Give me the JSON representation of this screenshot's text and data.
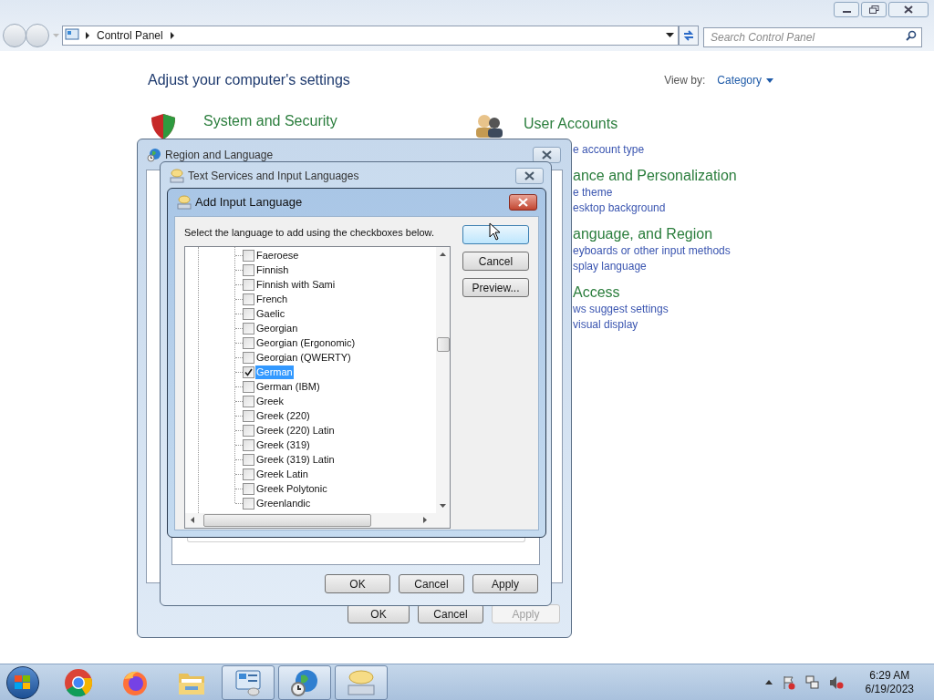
{
  "explorer": {
    "crumbs": [
      "Control Panel"
    ],
    "search_placeholder": "Search Control Panel"
  },
  "heading": "Adjust your computer's settings",
  "view_by": {
    "label": "View by:",
    "value": "Category"
  },
  "categories": [
    {
      "kind": "shield",
      "title": "System and Security"
    },
    {
      "kind": "users",
      "title": "User Accounts"
    }
  ],
  "partly_covered": [
    {
      "kind": "link",
      "text": "e account type"
    },
    {
      "kind": "heading",
      "text": "ance and Personalization"
    },
    {
      "kind": "link",
      "text": "e theme"
    },
    {
      "kind": "link",
      "text": "esktop background"
    },
    {
      "kind": "heading",
      "text": "anguage, and Region"
    },
    {
      "kind": "link",
      "text": "eyboards or other input methods"
    },
    {
      "kind": "link",
      "text": "splay language"
    },
    {
      "kind": "heading",
      "text": "Access"
    },
    {
      "kind": "link",
      "text": "ws suggest settings"
    },
    {
      "kind": "link",
      "text": "visual display"
    }
  ],
  "region_dialog": {
    "title": "Region and Language",
    "buttons": [
      {
        "label": "OK",
        "disabled": false
      },
      {
        "label": "Cancel",
        "disabled": false
      },
      {
        "label": "Apply",
        "disabled": true
      }
    ]
  },
  "text_services_dialog": {
    "title": "Text Services and Input Languages",
    "buttons": [
      {
        "label": "OK",
        "disabled": false
      },
      {
        "label": "Cancel",
        "disabled": false
      },
      {
        "label": "Apply",
        "disabled": false
      }
    ]
  },
  "add_language_dialog": {
    "title": "Add Input Language",
    "prompt": "Select the language to add using the checkboxes below.",
    "default_button_focused": true,
    "buttons": [
      {
        "label": "Cancel"
      },
      {
        "label": "Preview..."
      }
    ],
    "languages": [
      {
        "label": "Faeroese",
        "checked": false,
        "selected": false
      },
      {
        "label": "Finnish",
        "checked": false,
        "selected": false
      },
      {
        "label": "Finnish with Sami",
        "checked": false,
        "selected": false
      },
      {
        "label": "French",
        "checked": false,
        "selected": false
      },
      {
        "label": "Gaelic",
        "checked": false,
        "selected": false
      },
      {
        "label": "Georgian",
        "checked": false,
        "selected": false
      },
      {
        "label": "Georgian (Ergonomic)",
        "checked": false,
        "selected": false
      },
      {
        "label": "Georgian (QWERTY)",
        "checked": false,
        "selected": false
      },
      {
        "label": "German",
        "checked": true,
        "selected": true
      },
      {
        "label": "German (IBM)",
        "checked": false,
        "selected": false
      },
      {
        "label": "Greek",
        "checked": false,
        "selected": false
      },
      {
        "label": "Greek (220)",
        "checked": false,
        "selected": false
      },
      {
        "label": "Greek (220) Latin",
        "checked": false,
        "selected": false
      },
      {
        "label": "Greek (319)",
        "checked": false,
        "selected": false
      },
      {
        "label": "Greek (319) Latin",
        "checked": false,
        "selected": false
      },
      {
        "label": "Greek Latin",
        "checked": false,
        "selected": false
      },
      {
        "label": "Greek Polytonic",
        "checked": false,
        "selected": false
      },
      {
        "label": "Greenlandic",
        "checked": false,
        "selected": false
      }
    ]
  },
  "taskbar": {
    "apps": [
      {
        "kind": "chrome",
        "running": false
      },
      {
        "kind": "firefox",
        "running": false
      },
      {
        "kind": "folder",
        "running": false
      },
      {
        "kind": "control-panel",
        "running": true
      },
      {
        "kind": "globe-clock",
        "running": true
      },
      {
        "kind": "keyboard",
        "running": true
      }
    ],
    "clock": {
      "time": "6:29 AM",
      "date": "6/19/2023"
    }
  }
}
